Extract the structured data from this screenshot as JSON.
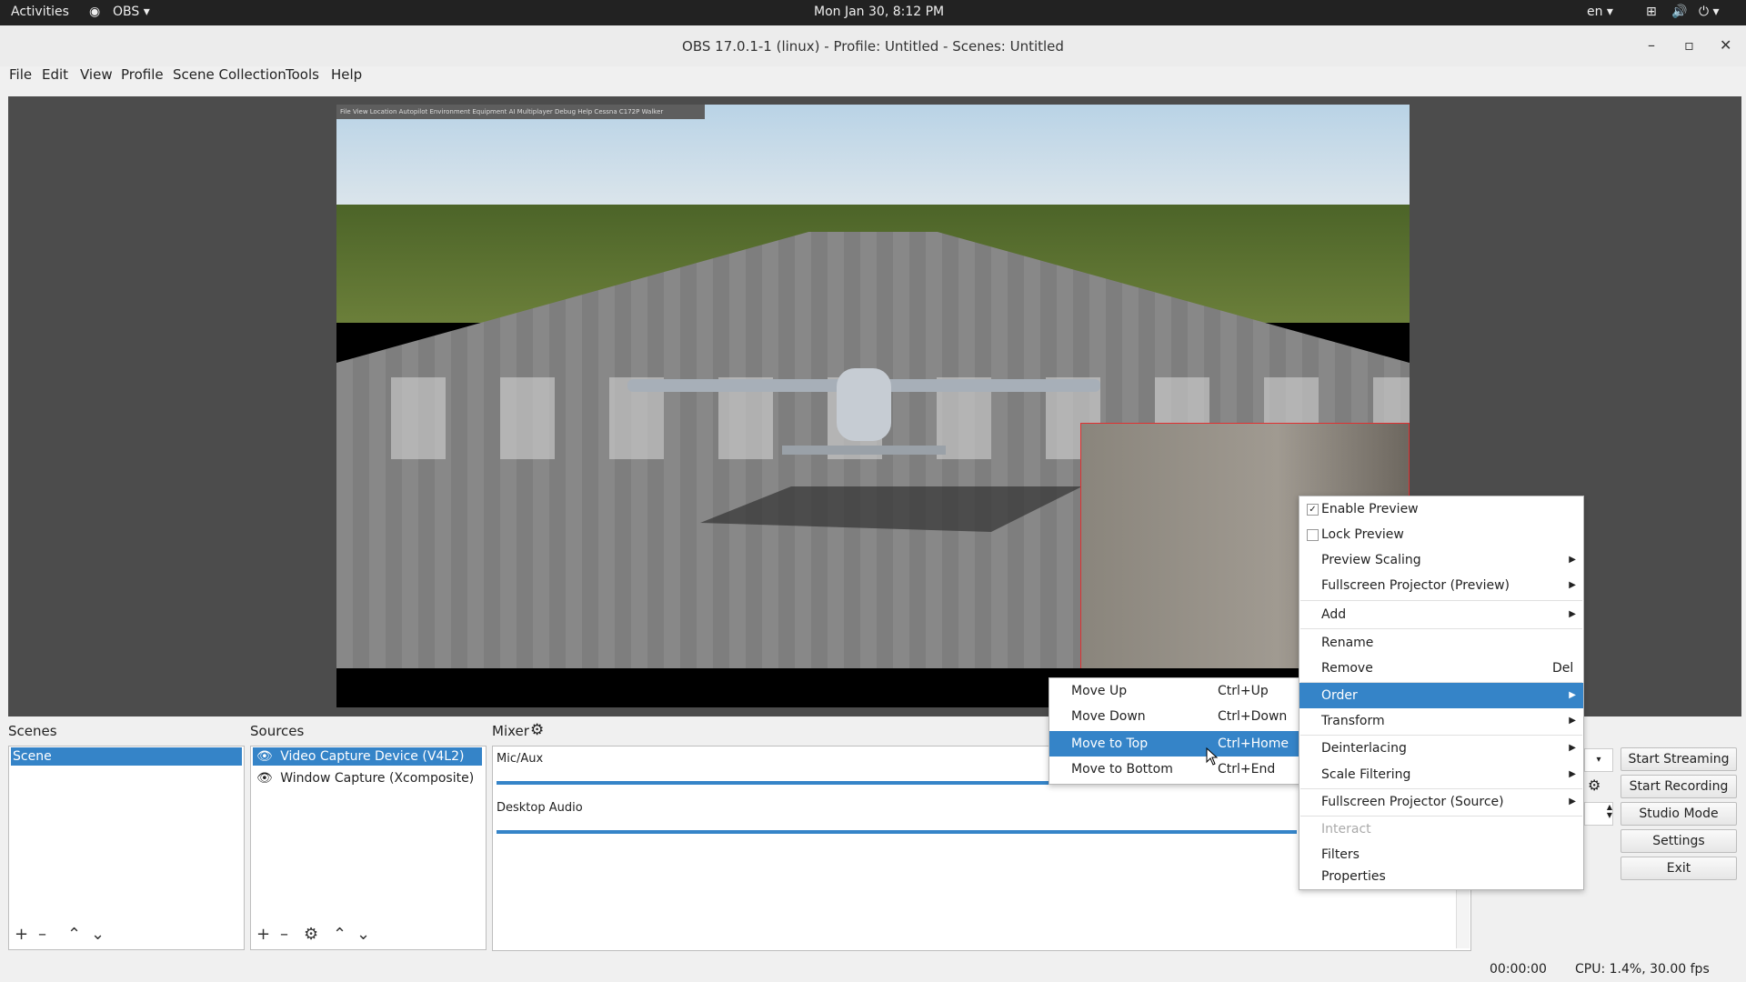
{
  "topbar": {
    "activities": "Activities",
    "app_menu": "OBS ▾",
    "clock": "Mon Jan 30,  8:12 PM",
    "lang": "en ▾"
  },
  "window": {
    "title": "OBS 17.0.1-1 (linux) - Profile: Untitled - Scenes: Untitled"
  },
  "menubar": [
    "File",
    "Edit",
    "View",
    "Profile",
    "Scene Collection",
    "Tools",
    "Help"
  ],
  "preview": {
    "sim_menu": "File   View   Location   Autopilot   Environment   Equipment   AI   Multiplayer   Debug   Help   Cessna C172P   Walker"
  },
  "scenes": {
    "label": "Scenes",
    "items": [
      "Scene"
    ]
  },
  "sources": {
    "label": "Sources",
    "items": [
      "Video Capture Device (V4L2)",
      "Window Capture (Xcomposite)"
    ]
  },
  "mixer": {
    "label": "Mixer",
    "channels": [
      "Mic/Aux",
      "Desktop Audio"
    ]
  },
  "controls": {
    "start_streaming": "Start Streaming",
    "start_recording": "Start Recording",
    "studio_mode": "Studio Mode",
    "settings": "Settings",
    "exit": "Exit"
  },
  "status": {
    "time": "00:00:00",
    "cpu": "CPU: 1.4%, 30.00 fps"
  },
  "context_menu": {
    "items": [
      {
        "label": "Enable Preview",
        "checked": true
      },
      {
        "label": "Lock Preview",
        "checked": false
      },
      {
        "label": "Preview Scaling"
      },
      {
        "label": "Fullscreen Projector (Preview)"
      },
      {
        "label": "Add"
      },
      {
        "label": "Rename"
      },
      {
        "label": "Remove",
        "shortcut": "Del"
      },
      {
        "label": "Order"
      },
      {
        "label": "Transform"
      },
      {
        "label": "Deinterlacing"
      },
      {
        "label": "Scale Filtering"
      },
      {
        "label": "Fullscreen Projector (Source)"
      },
      {
        "label": "Interact"
      },
      {
        "label": "Filters"
      },
      {
        "label": "Properties"
      }
    ]
  },
  "order_menu": {
    "items": [
      {
        "label": "Move Up",
        "shortcut": "Ctrl+Up"
      },
      {
        "label": "Move Down",
        "shortcut": "Ctrl+Down"
      },
      {
        "label": "Move to Top",
        "shortcut": "Ctrl+Home"
      },
      {
        "label": "Move to Bottom",
        "shortcut": "Ctrl+End"
      }
    ]
  },
  "colors": {
    "accent": "#3584c8",
    "selection_border": "#e03030"
  }
}
